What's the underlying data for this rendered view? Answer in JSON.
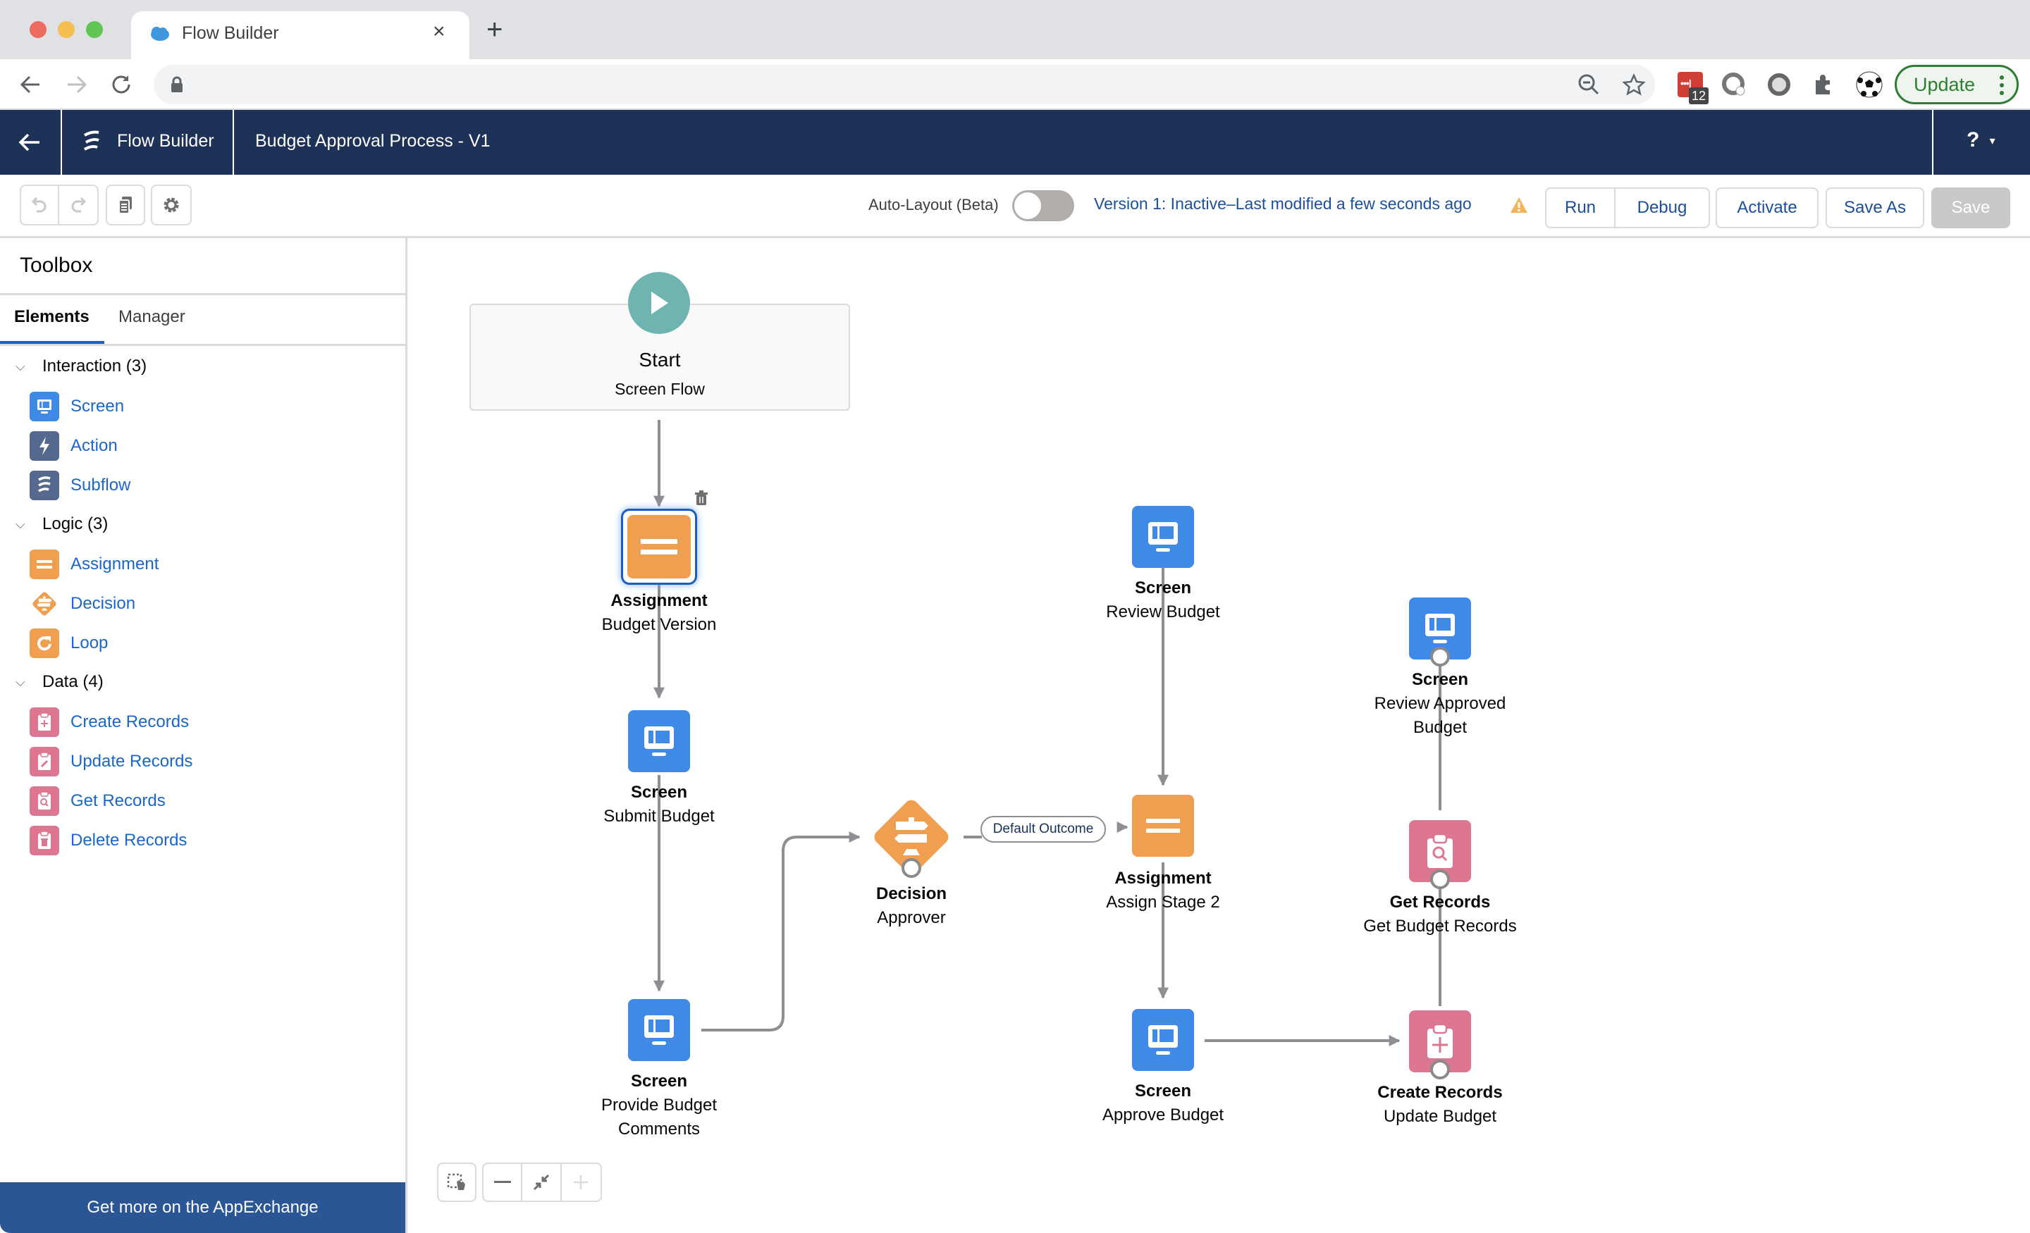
{
  "browser": {
    "tab_title": "Flow Builder",
    "tab_close": "×",
    "new_tab": "+",
    "address": "",
    "extension_badge": "12",
    "update_label": "Update"
  },
  "header": {
    "back_label": "←",
    "app_name": "Flow Builder",
    "flow_title": "Budget Approval Process - V1",
    "help_label": "?",
    "help_caret": "▾"
  },
  "toolbar": {
    "auto_layout_label": "Auto-Layout (Beta)",
    "auto_layout_on": false,
    "version_status": "Version 1: Inactive–Last modified a few seconds ago",
    "run": "Run",
    "debug": "Debug",
    "activate": "Activate",
    "save_as": "Save As",
    "save": "Save"
  },
  "toolbox": {
    "title": "Toolbox",
    "tabs": [
      {
        "label": "Elements",
        "active": true
      },
      {
        "label": "Manager",
        "active": false
      }
    ],
    "sections": [
      {
        "label": "Interaction (3)",
        "items": [
          {
            "label": "Screen",
            "icon": "screen-icon",
            "color": "#3e8ae6"
          },
          {
            "label": "Action",
            "icon": "lightning-icon",
            "color": "#54698d"
          },
          {
            "label": "Subflow",
            "icon": "flow-icon",
            "color": "#54698d"
          }
        ]
      },
      {
        "label": "Logic (3)",
        "items": [
          {
            "label": "Assignment",
            "icon": "equals-icon",
            "color": "#f09f51"
          },
          {
            "label": "Decision",
            "icon": "signpost-icon",
            "color": "#f09f51"
          },
          {
            "label": "Loop",
            "icon": "loop-icon",
            "color": "#f09f51"
          }
        ]
      },
      {
        "label": "Data (4)",
        "items": [
          {
            "label": "Create Records",
            "icon": "record-create-icon",
            "color": "#dc7691"
          },
          {
            "label": "Update Records",
            "icon": "record-update-icon",
            "color": "#dc7691"
          },
          {
            "label": "Get Records",
            "icon": "record-lookup-icon",
            "color": "#dc7691"
          },
          {
            "label": "Delete Records",
            "icon": "record-delete-icon",
            "color": "#dc7691"
          }
        ]
      }
    ],
    "appexchange": "Get more on the AppExchange"
  },
  "canvas": {
    "start": {
      "title": "Start",
      "subtitle": "Screen Flow"
    },
    "nodes": [
      {
        "id": "assign1",
        "type": "Assignment",
        "name": "Budget Version",
        "selected": true
      },
      {
        "id": "screen_submit",
        "type": "Screen",
        "name": "Submit Budget"
      },
      {
        "id": "screen_provide",
        "type": "Screen",
        "name": "Provide Budget Comments"
      },
      {
        "id": "decision",
        "type": "Decision",
        "name": "Approver"
      },
      {
        "id": "screen_review",
        "type": "Screen",
        "name": "Review Budget"
      },
      {
        "id": "assign2",
        "type": "Assignment",
        "name": "Assign Stage 2"
      },
      {
        "id": "screen_approve",
        "type": "Screen",
        "name": "Approve Budget"
      },
      {
        "id": "screen_review_approved",
        "type": "Screen",
        "name": "Review Approved Budget"
      },
      {
        "id": "get_records",
        "type": "Get Records",
        "name": "Get Budget Records"
      },
      {
        "id": "create_records",
        "type": "Create Records",
        "name": "Update Budget"
      }
    ],
    "connector_label": "Default Outcome"
  },
  "colors": {
    "header_bg": "#1e3157",
    "screen": "#3e8ae6",
    "logic": "#f09f51",
    "data": "#dc7691",
    "start": "#6fb4b1",
    "link": "#1b4f9c",
    "warning": "#f4b35a"
  }
}
